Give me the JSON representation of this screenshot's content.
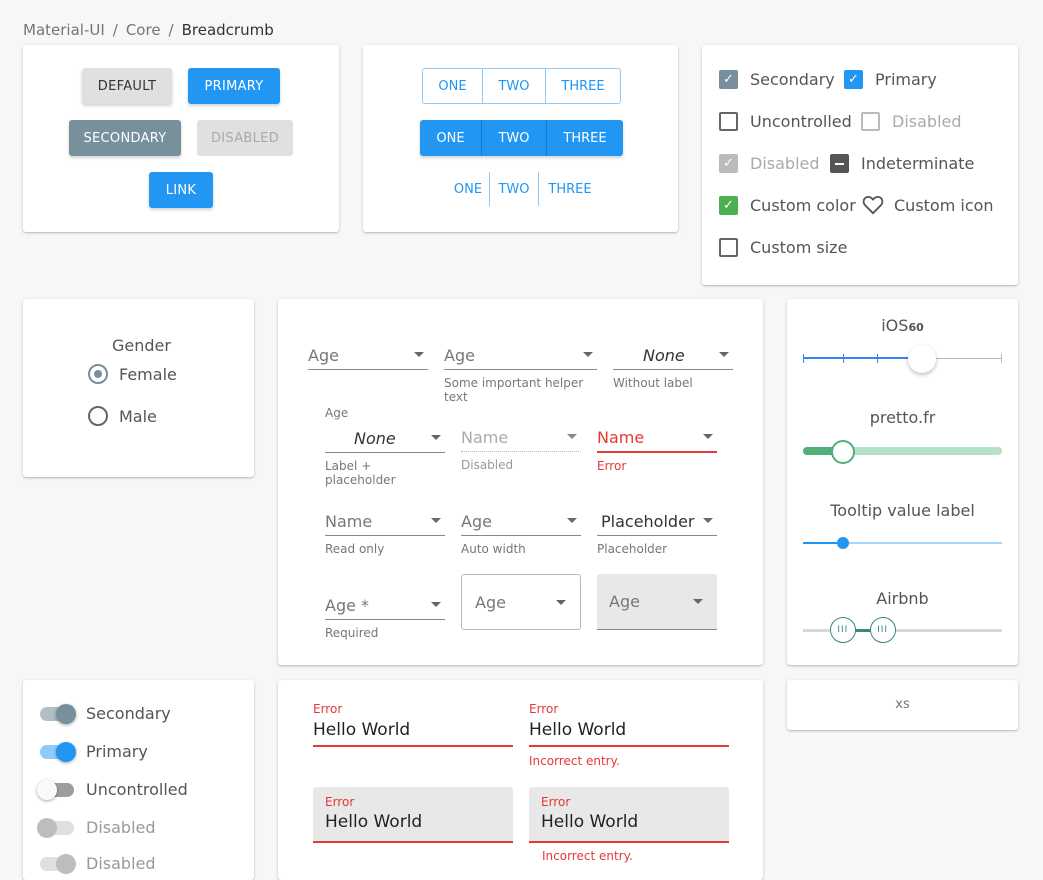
{
  "breadcrumb": {
    "items": [
      "Material-UI",
      "Core"
    ],
    "current": "Breadcrumb"
  },
  "buttons": {
    "default": "DEFAULT",
    "primary": "PRIMARY",
    "secondary": "SECONDARY",
    "disabled": "DISABLED",
    "link": "LINK"
  },
  "button_groups": {
    "outlined": [
      "ONE",
      "TWO",
      "THREE"
    ],
    "contained": [
      "ONE",
      "TWO",
      "THREE"
    ],
    "text": [
      "ONE",
      "TWO",
      "THREE"
    ]
  },
  "checkboxes": {
    "secondary": "Secondary",
    "primary": "Primary",
    "uncontrolled": "Uncontrolled",
    "disabled": "Disabled",
    "disabled_checked": "Disabled",
    "indeterminate": "Indeterminate",
    "custom_color": "Custom color",
    "custom_icon": "Custom icon",
    "custom_size": "Custom size"
  },
  "radio": {
    "legend": "Gender",
    "female": "Female",
    "male": "Male",
    "selected": "Female"
  },
  "selects": {
    "age1": {
      "label": "Age"
    },
    "age2": {
      "label": "Age",
      "helper": "Some important helper text"
    },
    "none1": {
      "value": "None",
      "helper": "Without label"
    },
    "none2": {
      "small_label": "Age",
      "value": "None",
      "helper": "Label + placeholder"
    },
    "name_dis": {
      "label": "Name",
      "helper": "Disabled"
    },
    "name_err": {
      "label": "Name",
      "helper": "Error"
    },
    "name_ro": {
      "label": "Name",
      "helper": "Read only"
    },
    "age_auto": {
      "label": "Age",
      "helper": "Auto width"
    },
    "placeholder": {
      "value": "Placeholder",
      "helper": "Placeholder"
    },
    "age_req": {
      "label": "Age *",
      "helper": "Required"
    },
    "age_outlined": {
      "label": "Age"
    },
    "age_filled": {
      "label": "Age"
    }
  },
  "sliders": {
    "ios": {
      "title_main": "iOS",
      "title_sub": "60",
      "value": 60
    },
    "pretto": {
      "title": "pretto.fr",
      "value": 20
    },
    "tooltip": {
      "title": "Tooltip value label",
      "value": 20
    },
    "airbnb": {
      "title": "Airbnb",
      "values": [
        20,
        40
      ]
    }
  },
  "xs_label": "xs",
  "switches": {
    "secondary": "Secondary",
    "primary": "Primary",
    "uncontrolled": "Uncontrolled",
    "disabled": "Disabled",
    "disabled_checked": "Disabled"
  },
  "textfields": {
    "f1": {
      "label": "Error",
      "value": "Hello World"
    },
    "f2": {
      "label": "Error",
      "value": "Hello World",
      "helper": "Incorrect entry."
    },
    "f3": {
      "label": "Error",
      "value": "Hello World"
    },
    "f4": {
      "label": "Error",
      "value": "Hello World",
      "helper": "Incorrect entry."
    }
  },
  "colors": {
    "primary": "#2196f3",
    "secondary": "#78909c",
    "error": "#e53935",
    "success": "#4caf50",
    "pretto": "#52af77",
    "airbnb": "#3a8589"
  }
}
